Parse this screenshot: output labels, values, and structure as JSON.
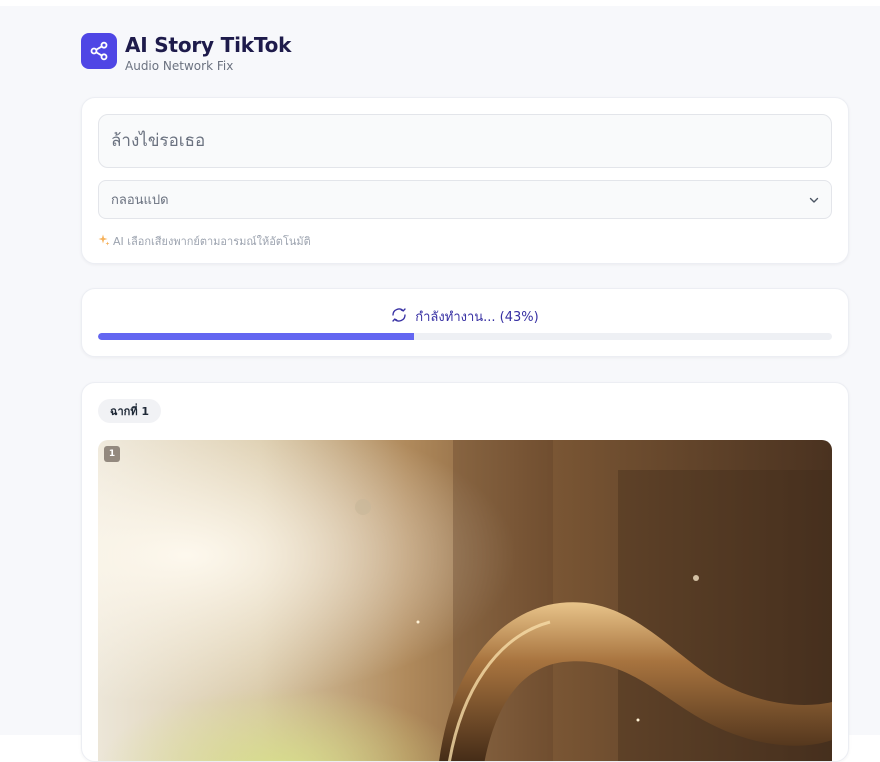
{
  "header": {
    "title": "AI Story TikTok",
    "subtitle": "Audio Network Fix",
    "logo_icon": "share-icon",
    "logo_color": "#4f46e5"
  },
  "input_card": {
    "story_placeholder": "ล้างไข่รอเธอ",
    "voice_select_value": "กลอนแปด",
    "hint_text": "AI เลือกเสียงพากย์ตามอารมณ์ให้อัตโนมัติ",
    "hint_icon": "sparkle-icon"
  },
  "progress": {
    "label": "กำลังทำงาน... (43%)",
    "percent": 43,
    "icon": "refresh-icon",
    "fill_color": "#6366f1"
  },
  "scene": {
    "badge": "ฉากที่ 1",
    "image_index": "1"
  }
}
